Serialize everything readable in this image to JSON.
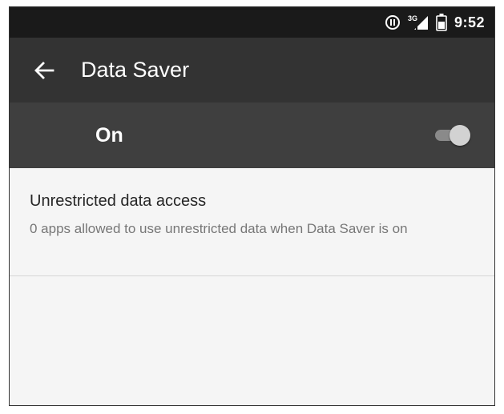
{
  "status_bar": {
    "time": "9:52",
    "network_type": "3G",
    "icons": [
      "data-saver-icon",
      "cell-signal-icon",
      "battery-icon"
    ]
  },
  "toolbar": {
    "back_icon": "arrow-back-icon",
    "title": "Data Saver"
  },
  "master_switch": {
    "label": "On",
    "checked": true
  },
  "list": {
    "items": [
      {
        "title": "Unrestricted data access",
        "summary": "0 apps allowed to use unrestricted data when Data Saver is on"
      }
    ]
  },
  "colors": {
    "status_bar_bg": "#1a1a1a",
    "toolbar_bg": "#333333",
    "switch_bar_bg": "#3f3f3f",
    "content_bg": "#f5f5f5",
    "title_text": "#262626",
    "summary_text": "#777777"
  }
}
